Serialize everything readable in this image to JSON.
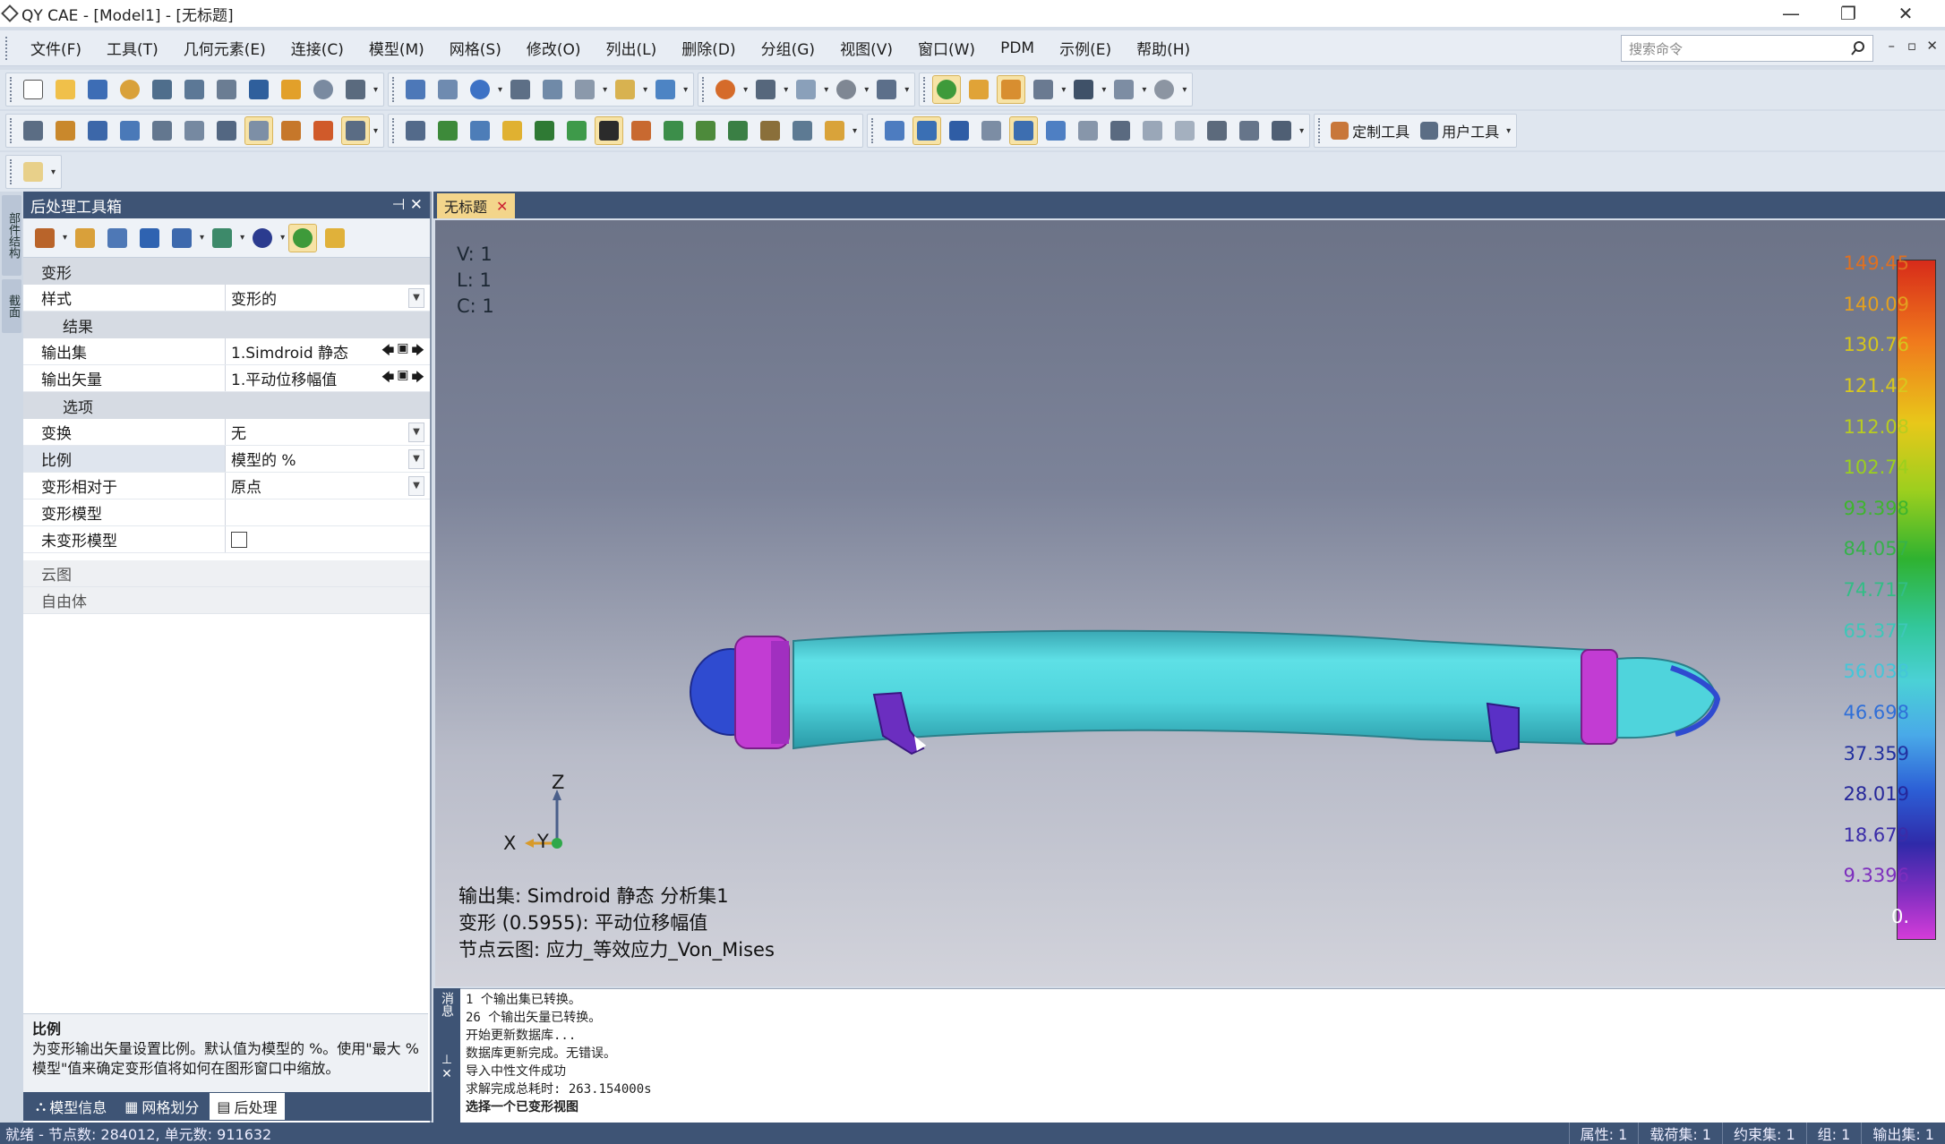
{
  "window": {
    "title": "QY CAE - [Model1] - [无标题]",
    "controls": [
      "—",
      "❐",
      "✕"
    ]
  },
  "menubar": {
    "items": [
      "文件(F)",
      "工具(T)",
      "几何元素(E)",
      "连接(C)",
      "模型(M)",
      "网格(S)",
      "修改(O)",
      "列出(L)",
      "删除(D)",
      "分组(G)",
      "视图(V)",
      "窗口(W)",
      "PDM",
      "示例(E)",
      "帮助(H)"
    ],
    "search_placeholder": "搜索命令",
    "mdi_controls": [
      "–",
      "▫",
      "✕"
    ]
  },
  "toolbar": {
    "custom_tools_label": "定制工具",
    "user_tools_label": "用户工具"
  },
  "left_tabs": [
    "部件结构",
    "截面"
  ],
  "panel": {
    "title": "后处理工具箱",
    "pin": "⊣ ✕",
    "deform_category": "变形",
    "style_label": "样式",
    "style_value": "变形的",
    "results_category": "结果",
    "output_set_label": "输出集",
    "output_set_value": "1.Simdroid 静态",
    "output_vector_label": "输出矢量",
    "output_vector_value": "1.平动位移幅值",
    "options_category": "选项",
    "transform_label": "变换",
    "transform_value": "无",
    "scale_label": "比例",
    "scale_value": "模型的 %",
    "deform_relative_label": "变形相对于",
    "deform_relative_value": "原点",
    "deformed_model_label": "变形模型",
    "undeformed_model_label": "未变形模型",
    "contour_category": "云图",
    "freebody_category": "自由体",
    "help_title": "比例",
    "help_text": "为变形输出矢量设置比例。默认值为模型的 %。使用\"最大 % 模型\"值来确定变形值将如何在图形窗口中缩放。"
  },
  "panel_tabs": [
    "模型信息",
    "网格划分",
    "后处理"
  ],
  "document_tab": "无标题",
  "viewport": {
    "view_info": [
      "V: 1",
      "L: 1",
      "C: 1"
    ],
    "axis_labels": {
      "x": "X",
      "y": "Y",
      "z": "Z"
    },
    "output_lines": [
      "输出集: Simdroid 静态 分析集1",
      "变形 (0.5955): 平动位移幅值",
      "节点云图: 应力_等效应力_Von_Mises"
    ]
  },
  "legend": {
    "values": [
      "149.45",
      "140.09",
      "130.76",
      "121.42",
      "112.08",
      "102.74",
      "93.398",
      "84.057",
      "74.717",
      "65.377",
      "56.038",
      "46.698",
      "37.359",
      "28.019",
      "18.679",
      "9.3396",
      "0."
    ],
    "colors": [
      "#e07020",
      "#e3a020",
      "#d6c51c",
      "#d8c81e",
      "#b8cc20",
      "#9bcf1e",
      "#3fb52e",
      "#36b24a",
      "#33bd86",
      "#3ec7b8",
      "#44c6d8",
      "#2f6fd8",
      "#22309f",
      "#25279a",
      "#3a2ca8",
      "#7d2ebd",
      "#ffffff"
    ]
  },
  "messages": {
    "strip_label": "消息",
    "lines": [
      "1 个输出集已转换。",
      "26 个输出矢量已转换。",
      "开始更新数据库...",
      "数据库更新完成。无错误。",
      "导入中性文件成功",
      "求解完成总耗时: 263.154000s",
      "选择一个已变形视图"
    ]
  },
  "statusbar": {
    "left": "就绪 - 节点数: 284012, 单元数: 911632",
    "right": [
      "属性: 1",
      "载荷集: 1",
      "约束集: 1",
      "组: 1",
      "输出集: 1"
    ]
  }
}
